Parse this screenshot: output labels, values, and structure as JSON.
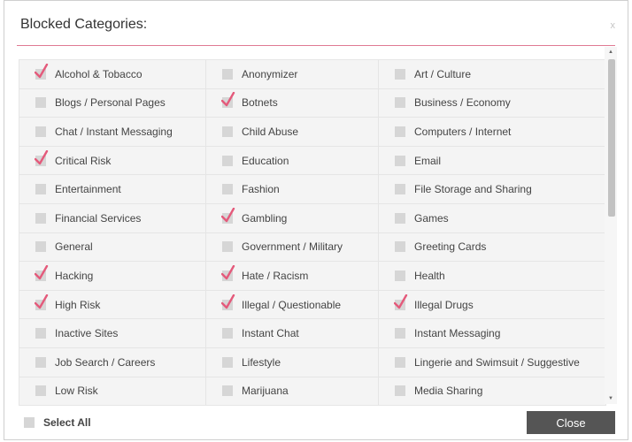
{
  "dialog": {
    "title": "Blocked Categories:",
    "close_icon_text": "x"
  },
  "accent_color": "#e45a7b",
  "categories": [
    {
      "label": "Alcohol & Tobacco",
      "checked": true
    },
    {
      "label": "Anonymizer",
      "checked": false
    },
    {
      "label": "Art / Culture",
      "checked": false
    },
    {
      "label": "Blogs / Personal Pages",
      "checked": false
    },
    {
      "label": "Botnets",
      "checked": true
    },
    {
      "label": "Business / Economy",
      "checked": false
    },
    {
      "label": "Chat / Instant Messaging",
      "checked": false
    },
    {
      "label": "Child Abuse",
      "checked": false
    },
    {
      "label": "Computers / Internet",
      "checked": false
    },
    {
      "label": "Critical Risk",
      "checked": true
    },
    {
      "label": "Education",
      "checked": false
    },
    {
      "label": "Email",
      "checked": false
    },
    {
      "label": "Entertainment",
      "checked": false
    },
    {
      "label": "Fashion",
      "checked": false
    },
    {
      "label": "File Storage and Sharing",
      "checked": false
    },
    {
      "label": "Financial Services",
      "checked": false
    },
    {
      "label": "Gambling",
      "checked": true
    },
    {
      "label": "Games",
      "checked": false
    },
    {
      "label": "General",
      "checked": false
    },
    {
      "label": "Government / Military",
      "checked": false
    },
    {
      "label": "Greeting Cards",
      "checked": false
    },
    {
      "label": "Hacking",
      "checked": true
    },
    {
      "label": "Hate / Racism",
      "checked": true
    },
    {
      "label": "Health",
      "checked": false
    },
    {
      "label": "High Risk",
      "checked": true
    },
    {
      "label": "Illegal / Questionable",
      "checked": true
    },
    {
      "label": "Illegal Drugs",
      "checked": true
    },
    {
      "label": "Inactive Sites",
      "checked": false
    },
    {
      "label": "Instant Chat",
      "checked": false
    },
    {
      "label": "Instant Messaging",
      "checked": false
    },
    {
      "label": "Job Search / Careers",
      "checked": false
    },
    {
      "label": "Lifestyle",
      "checked": false
    },
    {
      "label": "Lingerie and Swimsuit / Suggestive",
      "checked": false
    },
    {
      "label": "Low Risk",
      "checked": false
    },
    {
      "label": "Marijuana",
      "checked": false
    },
    {
      "label": "Media Sharing",
      "checked": false
    }
  ],
  "footer": {
    "select_all_label": "Select All",
    "select_all_checked": false,
    "close_label": "Close"
  }
}
